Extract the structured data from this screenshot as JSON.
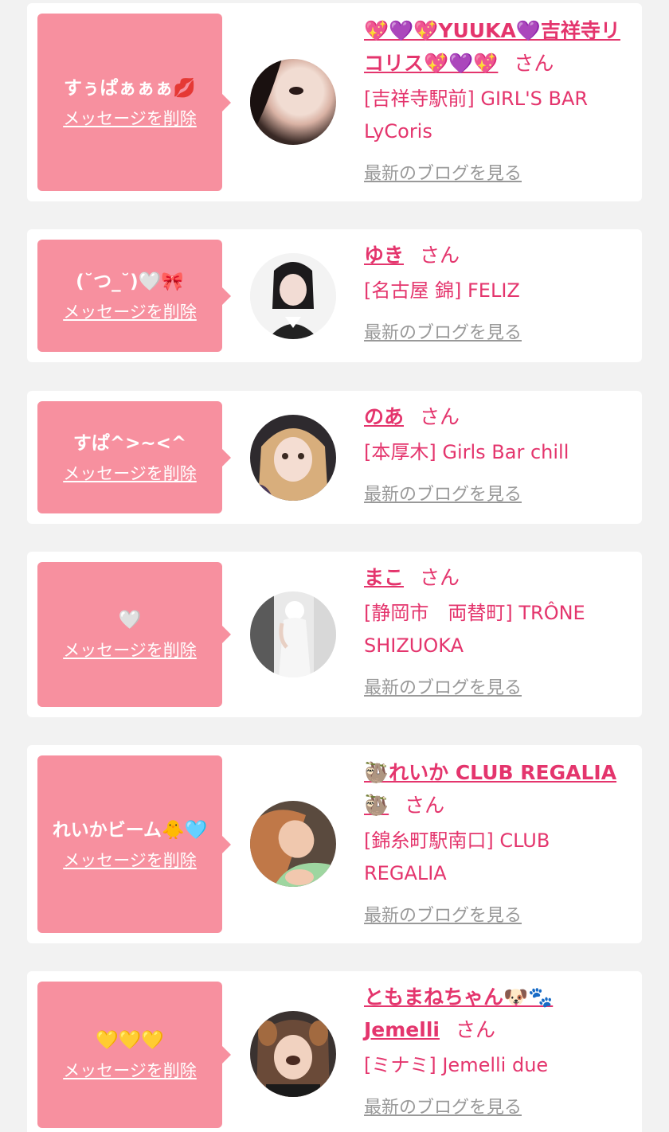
{
  "cards": [
    {
      "message": "すぅぱぁぁぁ💋",
      "delete_label": "メッセージを削除",
      "name": "💖💜💖YUUKA💜吉祥寺リコリス💖💜💖",
      "honorific": "さん",
      "shop": "[吉祥寺駅前] GIRL'S BAR LyCoris",
      "blog_label": "最新のブログを見る"
    },
    {
      "message": "(˘つ_˘)🤍🎀",
      "delete_label": "メッセージを削除",
      "name": "ゆき",
      "honorific": "さん",
      "shop": "[名古屋 錦] FELIZ",
      "blog_label": "最新のブログを見る"
    },
    {
      "message": "すぱ^>~<^",
      "delete_label": "メッセージを削除",
      "name": "のあ",
      "honorific": "さん",
      "shop": "[本厚木] Girls Bar chill",
      "blog_label": "最新のブログを見る"
    },
    {
      "message": "🤍",
      "delete_label": "メッセージを削除",
      "name": "まこ",
      "honorific": "さん",
      "shop": "[静岡市　両替町] TRÔNE SHIZUOKA",
      "blog_label": "最新のブログを見る"
    },
    {
      "message": "れいかビーム🐥🩵",
      "delete_label": "メッセージを削除",
      "name": "🦥れいか CLUB REGALIA🦥",
      "honorific": "さん",
      "shop": "[錦糸町駅南口] CLUB REGALIA",
      "blog_label": "最新のブログを見る"
    },
    {
      "message": "💛💛💛",
      "delete_label": "メッセージを削除",
      "name": "ともまねちゃん🐶🐾 Jemelli",
      "honorific": "さん",
      "shop": "[ミナミ] Jemelli due",
      "blog_label": "最新のブログを見る"
    }
  ]
}
